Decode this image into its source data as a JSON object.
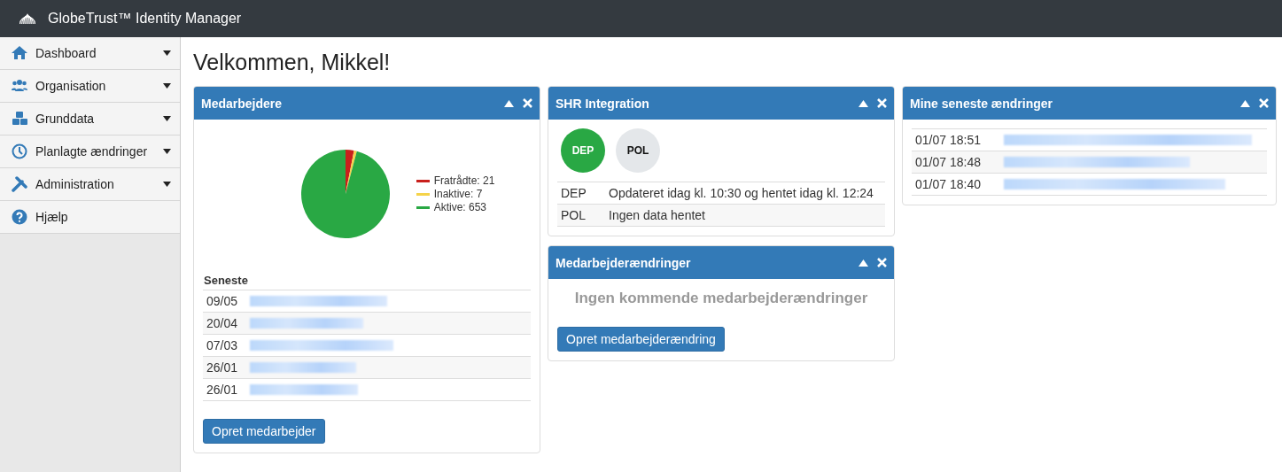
{
  "app_bar": {
    "title": "GlobeTrust™ Identity Manager"
  },
  "sidebar": {
    "items": [
      {
        "label": "Dashboard",
        "expandable": true
      },
      {
        "label": "Organisation",
        "expandable": true
      },
      {
        "label": "Grunddata",
        "expandable": true
      },
      {
        "label": "Planlagte ændringer",
        "expandable": true
      },
      {
        "label": "Administration",
        "expandable": true
      },
      {
        "label": "Hjælp",
        "expandable": false
      }
    ]
  },
  "heading": "Velkommen, Mikkel!",
  "employees_panel": {
    "title": "Medarbejdere",
    "legend": [
      {
        "color": "#c9201c"
      },
      {
        "color": "#f5d34a"
      },
      {
        "color": "#29a844"
      }
    ],
    "chart_data": {
      "type": "pie",
      "categories": [
        "Fratrådte: 21",
        "Inaktive: 7",
        "Aktive: 653"
      ],
      "values": [
        21,
        7,
        653
      ]
    },
    "recent_heading": "Seneste",
    "recent": [
      {
        "date": "09/05"
      },
      {
        "date": "20/04"
      },
      {
        "date": "07/03"
      },
      {
        "date": "26/01"
      },
      {
        "date": "26/01"
      }
    ],
    "button": "Opret medarbejder"
  },
  "shr_panel": {
    "title": "SHR Integration",
    "badges": [
      {
        "label": "DEP",
        "color": "#29a844"
      },
      {
        "label": "POL",
        "color": "#e4e7ea"
      }
    ],
    "rows": [
      {
        "code": "DEP",
        "status": "Opdateret idag kl. 10:30 og hentet idag kl. 12:24"
      },
      {
        "code": "POL",
        "status": "Ingen data hentet"
      }
    ]
  },
  "changes_panel": {
    "title": "Medarbejderændringer",
    "empty_message": "Ingen kommende medarbejderændringer",
    "button": "Opret medarbejderændring"
  },
  "my_changes_panel": {
    "title": "Mine seneste ændringer",
    "rows": [
      {
        "time": "01/07 18:51"
      },
      {
        "time": "01/07 18:48"
      },
      {
        "time": "01/07 18:40"
      }
    ]
  }
}
